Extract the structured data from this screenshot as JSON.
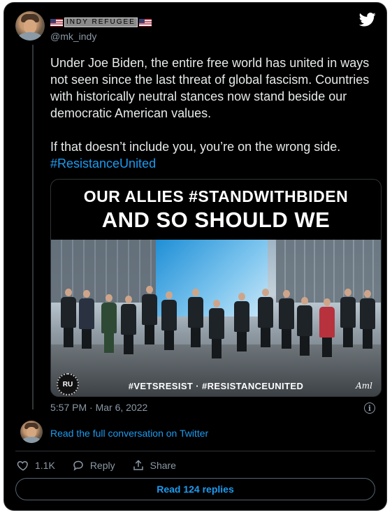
{
  "author": {
    "display_name": "INDY REFUGEE",
    "handle": "@mk_indy"
  },
  "tweet": {
    "paragraph_1": "Under Joe Biden, the entire free world has united in ways not seen since the last threat of global fascism. Countries with historically neutral stances now stand beside our democratic American values.",
    "paragraph_2_text": "If that doesn’t include you, you’re on the wrong side.",
    "paragraph_2_hashtag": "#ResistanceUnited"
  },
  "media": {
    "headline_line_1": "OUR ALLIES #STANDWITHBIDEN",
    "headline_line_2": "AND SO SHOULD WE",
    "caption": "#VETSRESIST · #RESISTANCEUNITED",
    "badge": "RU",
    "signature": "Aml"
  },
  "timestamp": "5:57 PM · Mar 6, 2022",
  "conversation_link": "Read the full conversation on Twitter",
  "actions": {
    "like_count": "1.1K",
    "reply_label": "Reply",
    "share_label": "Share"
  },
  "read_replies_label": "Read 124 replies",
  "colors": {
    "background": "#000000",
    "text": "#e7e9ea",
    "muted": "#8b98a5",
    "link": "#1d9bf0"
  },
  "icons": [
    "twitter-bird-icon",
    "info-icon",
    "heart-icon",
    "reply-icon",
    "share-icon"
  ]
}
